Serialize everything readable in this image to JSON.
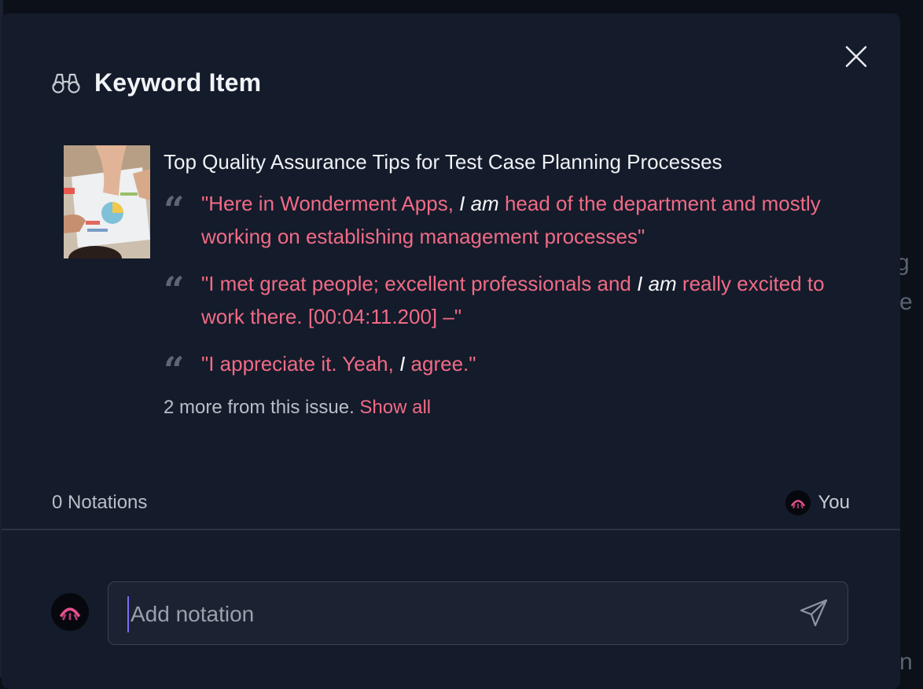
{
  "background": {
    "glyph_1": "g",
    "glyph_2": "e",
    "glyph_3": "n"
  },
  "modal": {
    "title": "Keyword Item",
    "title_icon": "binoculars-icon",
    "close_icon": "close-icon"
  },
  "item": {
    "title": "Top Quality Assurance Tips for Test Case Planning Processes",
    "quotes": [
      {
        "before": "\"Here in Wonderment Apps, ",
        "keyword": "I am",
        "after": " head of the department and mostly working on establishing management processes\""
      },
      {
        "before": "\"I met great people; excellent professionals and ",
        "keyword": "I am",
        "after": " really excited to work there. [00:04:11.200] –\""
      },
      {
        "before": "\"I appreciate it. Yeah, ",
        "keyword": "I",
        "after": " agree.\""
      }
    ],
    "more_text": "2 more from this issue. ",
    "show_all": "Show all"
  },
  "notations": {
    "count_label": "0 Notations",
    "user_label": "You"
  },
  "composer": {
    "placeholder": "Add notation",
    "send_icon": "send-icon"
  },
  "colors": {
    "accent": "#f06b86",
    "modal_bg": "#141b2a",
    "page_bg": "#0b1019"
  }
}
